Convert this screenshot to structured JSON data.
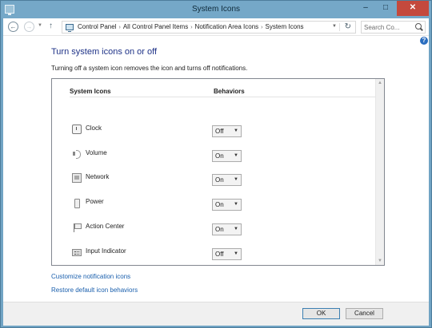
{
  "window": {
    "title": "System Icons"
  },
  "title_buttons": {
    "minimize": "–",
    "maximize": "□",
    "close": "✕"
  },
  "address": {
    "breadcrumbs": [
      "Control Panel",
      "All Control Panel Items",
      "Notification Area Icons",
      "System Icons"
    ],
    "separator": "›",
    "search_placeholder": "Search Co..."
  },
  "main": {
    "heading": "Turn system icons on or off",
    "description": "Turning off a system icon removes the icon and turns off notifications.",
    "columns": {
      "icons": "System Icons",
      "behaviors": "Behaviors"
    },
    "rows": [
      {
        "label": "Clock",
        "value": "Off",
        "icon": "clock-icon"
      },
      {
        "label": "Volume",
        "value": "On",
        "icon": "volume-icon"
      },
      {
        "label": "Network",
        "value": "On",
        "icon": "network-icon"
      },
      {
        "label": "Power",
        "value": "On",
        "icon": "power-icon"
      },
      {
        "label": "Action Center",
        "value": "On",
        "icon": "action-center-icon"
      },
      {
        "label": "Input Indicator",
        "value": "Off",
        "icon": "input-indicator-icon"
      }
    ]
  },
  "links": {
    "customize": "Customize notification icons",
    "restore": "Restore default icon behaviors"
  },
  "footer": {
    "ok": "OK",
    "cancel": "Cancel"
  },
  "colors": {
    "titlebar": "#75a8c8",
    "heading": "#1e3287",
    "link": "#1a5fad",
    "close_button": "#c4493d"
  }
}
